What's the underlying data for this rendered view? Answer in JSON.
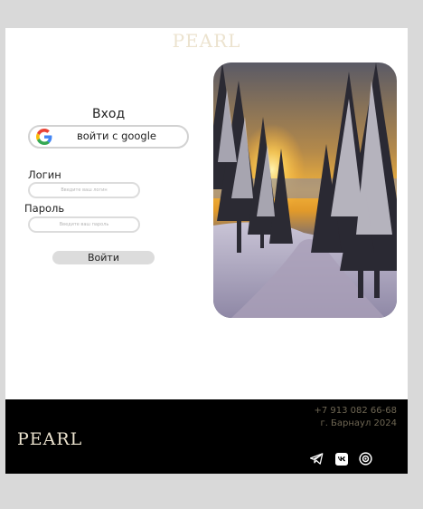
{
  "header": {
    "brand": "PEARL"
  },
  "login": {
    "title": "Вход",
    "google_label": "войти с google",
    "login_label": "Логин",
    "login_placeholder": "Введите ваш логин",
    "password_label": "Пароль",
    "password_placeholder": "Введите ваш пароль",
    "submit_label": "Войти"
  },
  "footer": {
    "brand": "PEARL",
    "phone": "+7 913 082 66-68",
    "address": "г. Барнаул 2024",
    "socials": [
      "telegram-icon",
      "vk-icon",
      "instagram-icon"
    ]
  },
  "colors": {
    "brand": "#ece3cf",
    "footer_bg": "#000000",
    "footer_text": "#6e6653"
  }
}
